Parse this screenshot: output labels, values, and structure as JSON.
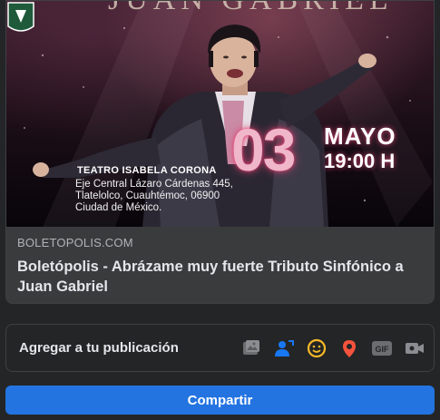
{
  "link_preview": {
    "image": {
      "banner_top_text": "JUAN GABRIEL",
      "date_day": "03",
      "date_month": "MAYO",
      "date_time": "19:00 H",
      "venue_name": "TEATRO ISABELA CORONA",
      "venue_address": "Eje Central Lázaro Cárdenas 445, Tlatelolco, Cuauhtémoc, 06900 Ciudad de México."
    },
    "domain": "BOLETOPOLIS.COM",
    "title": "Boletópolis - Abrázame muy fuerte Tributo Sinfónico a Juan Gabriel"
  },
  "add_to_post": {
    "label": "Agregar a tu publicación",
    "icons": [
      "photo-video-icon",
      "tag-people-icon",
      "feeling-icon",
      "check-in-icon",
      "gif-icon",
      "live-video-icon"
    ]
  },
  "share_button": {
    "label": "Compartir"
  },
  "colors": {
    "background": "#242526",
    "card": "#3a3b3c",
    "accent": "#2374e1",
    "photo_icon": "#45bd62",
    "tag_icon": "#1877f2",
    "feeling_icon": "#f7b928",
    "checkin_icon": "#f5533d",
    "muted_icon": "#b0b3b8"
  }
}
